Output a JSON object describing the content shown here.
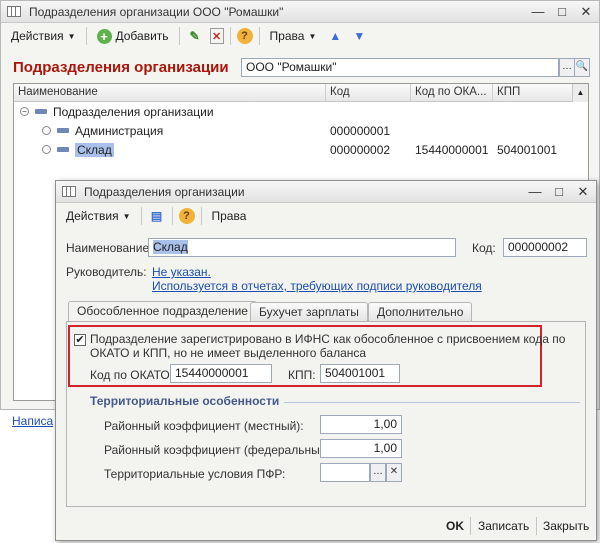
{
  "back_window": {
    "title": "Подразделения организации ООО \"Ромашки\"",
    "toolbar": {
      "actions": "Действия",
      "add": "Добавить",
      "rights": "Права"
    },
    "header_title": "Подразделения организации",
    "org_value": "ООО \"Ромашки\"",
    "columns": [
      "Наименование",
      "Код",
      "Код по ОКА...",
      "КПП"
    ],
    "rows": [
      {
        "name": "Подразделения организации",
        "code": "",
        "okato": "",
        "kpp": ""
      },
      {
        "name": "Администрация",
        "code": "000000001",
        "okato": "",
        "kpp": ""
      },
      {
        "name": "Склад",
        "code": "000000002",
        "okato": "15440000001",
        "kpp": "504001001"
      }
    ],
    "partial_link": "Написа"
  },
  "dialog": {
    "title": "Подразделения организации",
    "toolbar": {
      "actions": "Действия",
      "rights": "Права"
    },
    "name_label": "Наименование:",
    "name_value": "Склад",
    "code_label": "Код:",
    "code_value": "000000002",
    "head_label": "Руководитель:",
    "head_value": "Не указан.",
    "head_hint": "Используется в отчетах, требующих подписи руководителя",
    "tabs": [
      "Обособленное подразделение",
      "Бухучет зарплаты",
      "Дополнительно"
    ],
    "separate_checkbox": {
      "checked": true,
      "text_line1": "Подразделение зарегистрировано в ИФНС как обособленное с присвоением кода по",
      "text_line2": "ОКАТО и КПП, но не имеет выделенного баланса"
    },
    "okato_label": "Код по ОКАТО:",
    "okato_value": "15440000001",
    "kpp_label": "КПП:",
    "kpp_value": "504001001",
    "territorial": {
      "title": "Территориальные особенности",
      "local_coef_label": "Районный коэффициент (местный):",
      "local_coef_value": "1,00",
      "federal_coef_label": "Районный коэффициент (федеральный):",
      "federal_coef_value": "1,00",
      "pfr_label": "Территориальные условия ПФР:",
      "pfr_value": ""
    },
    "footer": {
      "ok": "OK",
      "save": "Записать",
      "close": "Закрыть"
    }
  },
  "colors": {
    "accent_red": "#a8160c",
    "highlight_border": "#d2232a",
    "link": "#1d4fb0",
    "selection": "#a9c1ea"
  }
}
